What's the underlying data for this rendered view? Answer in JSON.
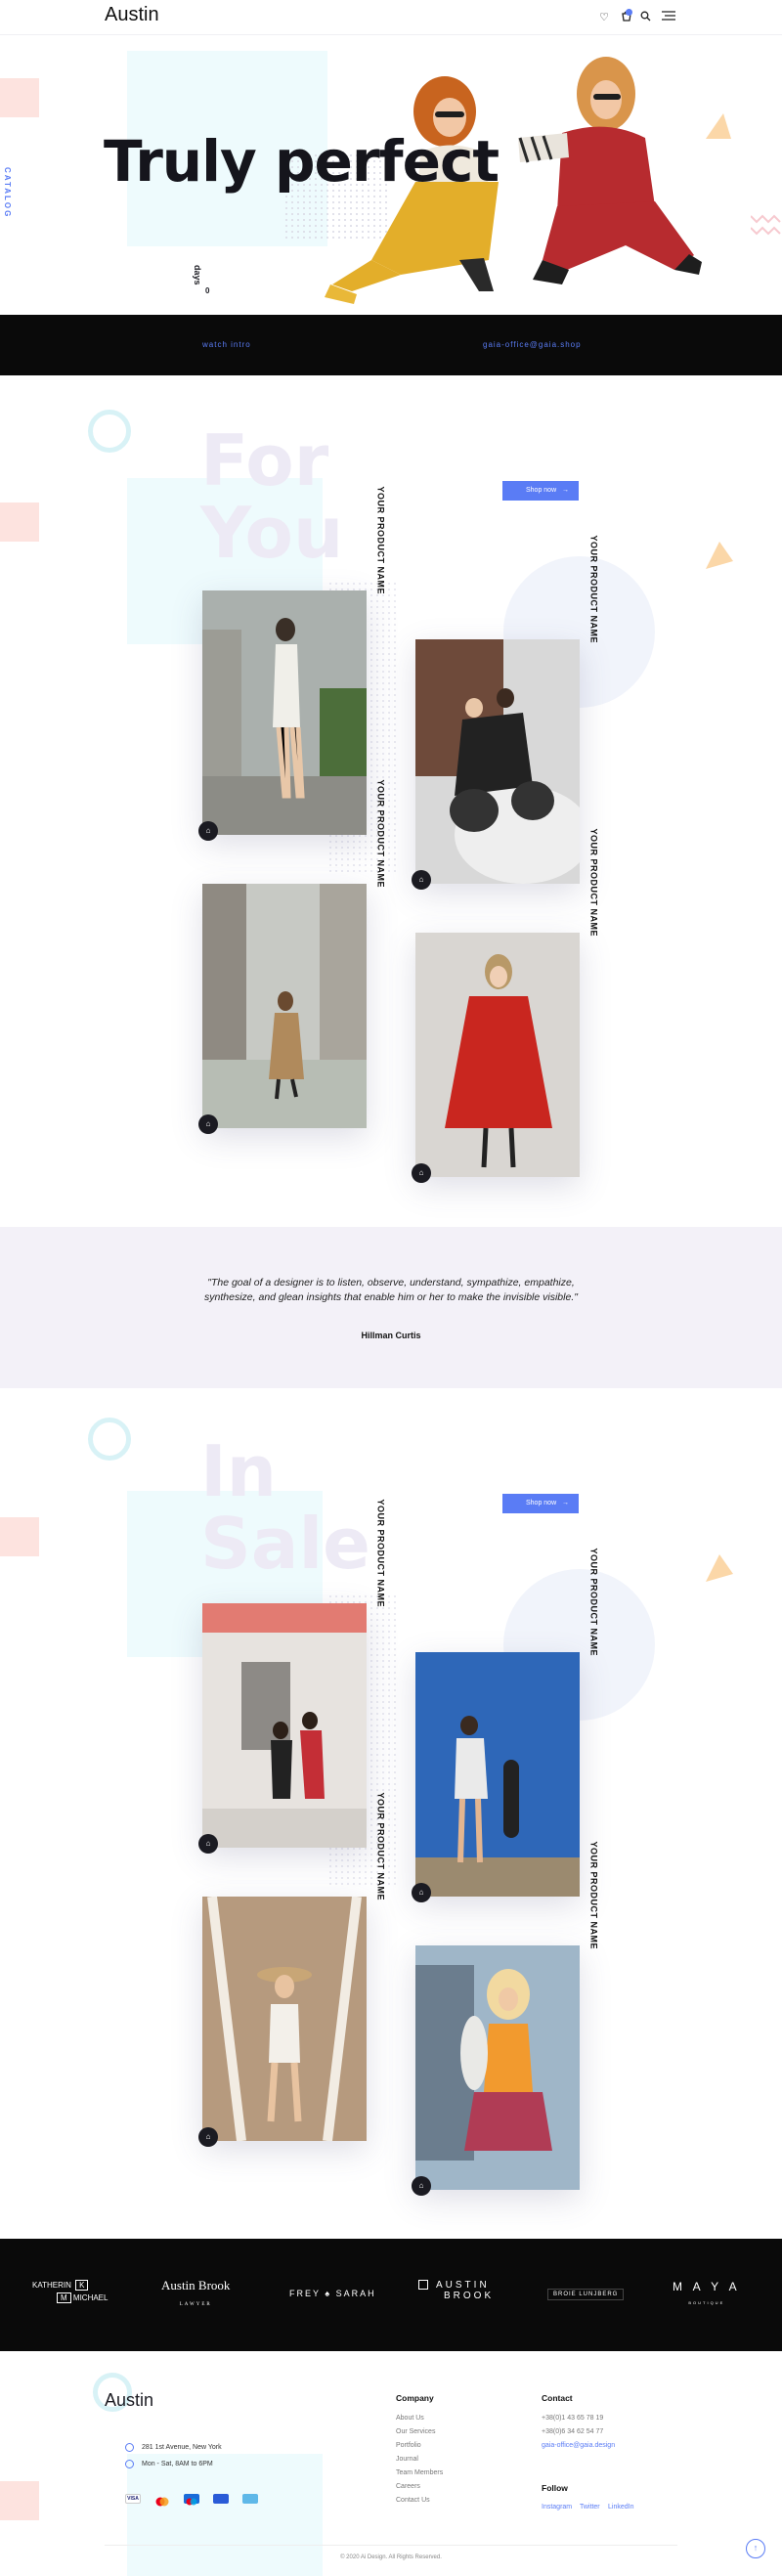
{
  "header": {
    "logo": "Austin",
    "icons": [
      "heart-icon",
      "cart-icon",
      "search-icon",
      "menu-icon"
    ]
  },
  "hero": {
    "side_label": "CATALOG",
    "title": "Truly perfect",
    "days_label": "days",
    "days_value": "0"
  },
  "bar": {
    "left_link": "watch intro",
    "right_link": "gaia-office@gaia.shop"
  },
  "for_you": {
    "big_word_1": "For",
    "big_word_2": "You",
    "button": "Shop now",
    "products": [
      {
        "name": "YOUR PRODUCT NAME"
      },
      {
        "name": "YOUR PRODUCT NAME"
      },
      {
        "name": "YOUR PRODUCT NAME"
      },
      {
        "name": "YOUR PRODUCT NAME"
      }
    ]
  },
  "quote": {
    "text": "\"The goal of a designer is to listen, observe, understand, sympathize, empathize, synthesize, and glean insights that enable him or her to make the invisible visible.\"",
    "author": "Hillman Curtis"
  },
  "in_sale": {
    "big_word_1": "In",
    "big_word_2": "Sale",
    "button": "Shop now",
    "products": [
      {
        "name": "YOUR PRODUCT NAME"
      },
      {
        "name": "YOUR PRODUCT NAME"
      },
      {
        "name": "YOUR PRODUCT NAME"
      },
      {
        "name": "YOUR PRODUCT NAME"
      }
    ]
  },
  "brands": {
    "items": [
      "KATHERIN",
      "K",
      "M",
      "MICHAEL",
      "Austin Brook",
      "LAWYER",
      "FREY",
      "SARAH",
      "AUSTIN",
      "BROOK",
      "BROIE LUNJBERG",
      "M A Y A",
      "BOUTIQUE"
    ]
  },
  "footer": {
    "logo": "Austin",
    "address": "281 1st Avenue, New York",
    "hours": "Mon - Sat, 8AM to 6PM",
    "company_heading": "Company",
    "company_links": [
      "About Us",
      "Our Services",
      "Portfolio",
      "Journal",
      "Team Members",
      "Careers",
      "Contact Us"
    ],
    "contact_heading": "Contact",
    "phone_1": "+38(0)1 43 65 78 19",
    "phone_2": "+38(0)6 34 62 54 77",
    "email": "gaia-office@gaia.design",
    "follow_heading": "Follow",
    "social": [
      "Instagram",
      "Twitter",
      "LinkedIn"
    ],
    "copyright": "© 2020 Ai Design. All Rights Reserved.",
    "payments": [
      "visa-icon",
      "mastercard-icon",
      "maestro-icon",
      "paypal-icon",
      "amex-icon"
    ]
  },
  "colors": {
    "accent": "#5a7cf5",
    "dark": "#0a0a0a",
    "light_purple": "#f3f1f8"
  }
}
